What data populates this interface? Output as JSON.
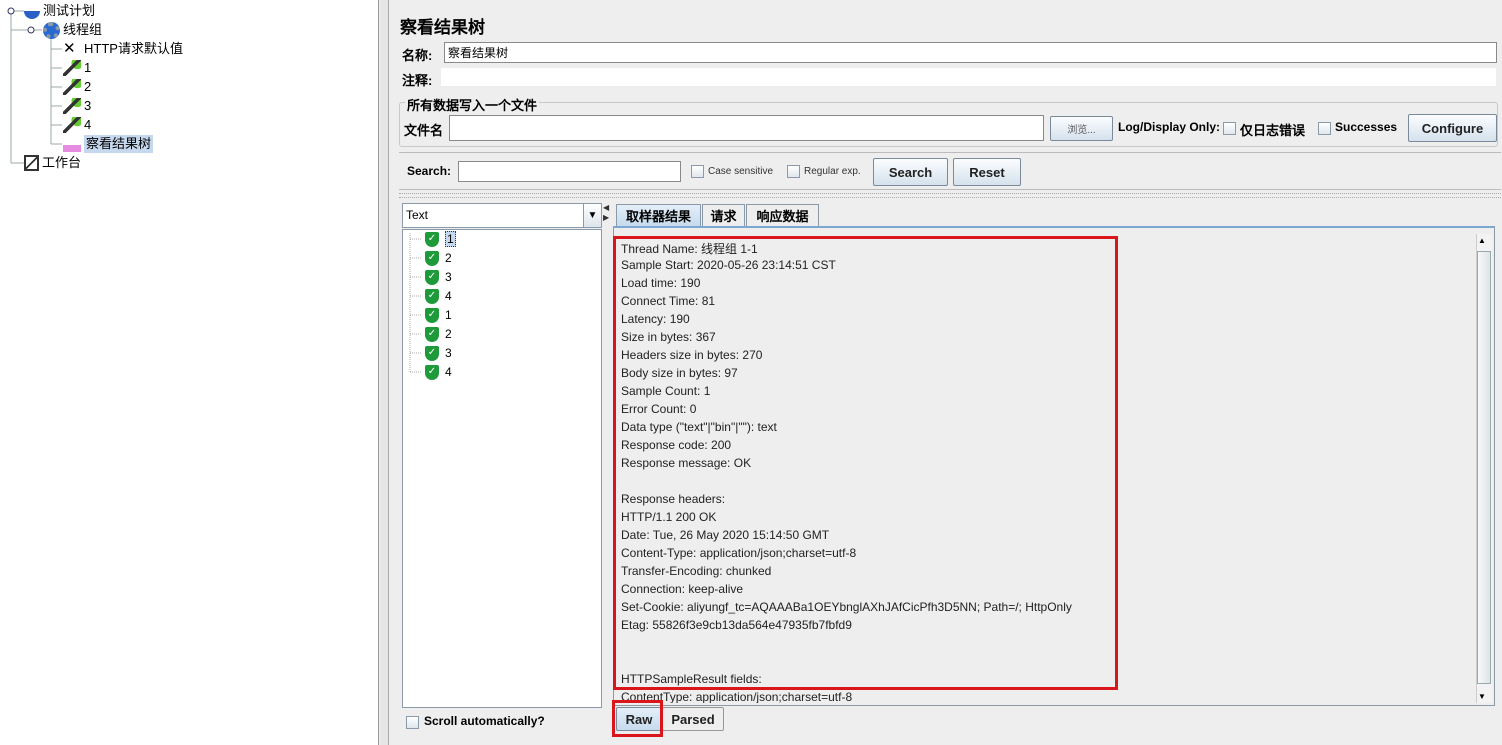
{
  "tree": {
    "nodes": [
      {
        "label": "测试计划",
        "icon": "test-plan-icon"
      },
      {
        "label": "线程组",
        "icon": "gear-icon"
      },
      {
        "label": "HTTP请求默认值",
        "icon": "tools-icon"
      },
      {
        "label": "1",
        "icon": "sampler-pipette-icon"
      },
      {
        "label": "2",
        "icon": "sampler-pipette-icon"
      },
      {
        "label": "3",
        "icon": "sampler-pipette-icon"
      },
      {
        "label": "4",
        "icon": "sampler-pipette-icon"
      },
      {
        "label": "察看结果树",
        "icon": "listener-chart-icon",
        "selected": true
      },
      {
        "label": "工作台",
        "icon": "workbench-icon"
      }
    ]
  },
  "panel": {
    "title": "察看结果树",
    "name_label": "名称:",
    "name_value": "察看结果树",
    "comment_label": "注释:",
    "comment_value": "",
    "file_group": "所有数据写入一个文件",
    "filename_label": "文件名",
    "filename_value": "",
    "browse": "浏览...",
    "log_display": "Log/Display Only:",
    "errors_only": "仅日志错误",
    "successes": "Successes",
    "configure": "Configure"
  },
  "search": {
    "label": "Search:",
    "value": "",
    "case": "Case sensitive",
    "regex": "Regular exp.",
    "search_btn": "Search",
    "reset_btn": "Reset"
  },
  "results": {
    "renderer": "Text",
    "items": [
      "1",
      "2",
      "3",
      "4",
      "1",
      "2",
      "3",
      "4"
    ],
    "status_color": "#1f9a3a",
    "scroll_auto": "Scroll automatically?"
  },
  "tabs": [
    "取样器结果",
    "请求",
    "响应数据"
  ],
  "content": {
    "lines": [
      "Thread Name: 线程组 1-1",
      "Sample Start: 2020-05-26 23:14:51 CST",
      "Load time: 190",
      "Connect Time: 81",
      "Latency: 190",
      "Size in bytes: 367",
      "Headers size in bytes: 270",
      "Body size in bytes: 97",
      "Sample Count: 1",
      "Error Count: 0",
      "Data type (\"text\"|\"bin\"|\"\"): text",
      "Response code: 200",
      "Response message: OK",
      "",
      "Response headers:",
      "HTTP/1.1 200 OK",
      "Date: Tue, 26 May 2020 15:14:50 GMT",
      "Content-Type: application/json;charset=utf-8",
      "Transfer-Encoding: chunked",
      "Connection: keep-alive",
      "Set-Cookie: aliyungf_tc=AQAAABa1OEYbnglAXhJAfCicPfh3D5NN; Path=/; HttpOnly",
      "Etag: 55826f3e9cb13da564e47935fb7fbfd9",
      "",
      "",
      "HTTPSampleResult fields:",
      "ContentType: application/json;charset=utf-8"
    ]
  },
  "view_buttons": {
    "raw": "Raw",
    "parsed": "Parsed"
  },
  "highlight_color": "#d9161c"
}
